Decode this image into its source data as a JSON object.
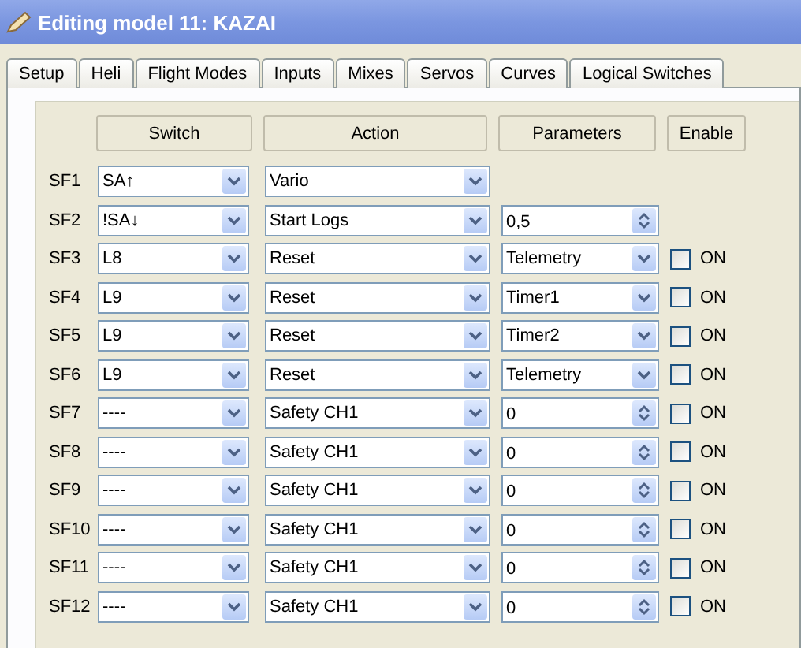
{
  "window": {
    "title": "Editing model 11: KAZAI"
  },
  "tabs": [
    {
      "label": "Setup",
      "selected": false
    },
    {
      "label": "Heli",
      "selected": false
    },
    {
      "label": "Flight Modes",
      "selected": false
    },
    {
      "label": "Inputs",
      "selected": false
    },
    {
      "label": "Mixes",
      "selected": false
    },
    {
      "label": "Servos",
      "selected": false
    },
    {
      "label": "Curves",
      "selected": false
    },
    {
      "label": "Logical Switches",
      "selected": false
    }
  ],
  "headers": [
    "Switch",
    "Action",
    "Parameters",
    "Enable"
  ],
  "rows": [
    {
      "label": "SF1",
      "switch": "SA↑",
      "action": "Vario",
      "parameter": {
        "kind": "none"
      }
    },
    {
      "label": "SF2",
      "switch": "!SA↓",
      "action": "Start Logs",
      "parameter": {
        "kind": "spin",
        "value": "0,5"
      }
    },
    {
      "label": "SF3",
      "switch": "L8",
      "action": "Reset",
      "parameter": {
        "kind": "combo",
        "value": "Telemetry"
      },
      "enable": {
        "label": "ON",
        "checked": false
      }
    },
    {
      "label": "SF4",
      "switch": "L9",
      "action": "Reset",
      "parameter": {
        "kind": "combo",
        "value": "Timer1"
      },
      "enable": {
        "label": "ON",
        "checked": false
      }
    },
    {
      "label": "SF5",
      "switch": "L9",
      "action": "Reset",
      "parameter": {
        "kind": "combo",
        "value": "Timer2"
      },
      "enable": {
        "label": "ON",
        "checked": false
      }
    },
    {
      "label": "SF6",
      "switch": "L9",
      "action": "Reset",
      "parameter": {
        "kind": "combo",
        "value": "Telemetry"
      },
      "enable": {
        "label": "ON",
        "checked": false
      }
    },
    {
      "label": "SF7",
      "switch": "----",
      "action": "Safety CH1",
      "parameter": {
        "kind": "spin",
        "value": "0"
      },
      "enable": {
        "label": "ON",
        "checked": false
      }
    },
    {
      "label": "SF8",
      "switch": "----",
      "action": "Safety CH1",
      "parameter": {
        "kind": "spin",
        "value": "0"
      },
      "enable": {
        "label": "ON",
        "checked": false
      }
    },
    {
      "label": "SF9",
      "switch": "----",
      "action": "Safety CH1",
      "parameter": {
        "kind": "spin",
        "value": "0"
      },
      "enable": {
        "label": "ON",
        "checked": false
      }
    },
    {
      "label": "SF10",
      "switch": "----",
      "action": "Safety CH1",
      "parameter": {
        "kind": "spin",
        "value": "0"
      },
      "enable": {
        "label": "ON",
        "checked": false
      }
    },
    {
      "label": "SF11",
      "switch": "----",
      "action": "Safety CH1",
      "parameter": {
        "kind": "spin",
        "value": "0"
      },
      "enable": {
        "label": "ON",
        "checked": false
      }
    },
    {
      "label": "SF12",
      "switch": "----",
      "action": "Safety CH1",
      "parameter": {
        "kind": "spin",
        "value": "0"
      },
      "enable": {
        "label": "ON",
        "checked": false
      }
    }
  ]
}
